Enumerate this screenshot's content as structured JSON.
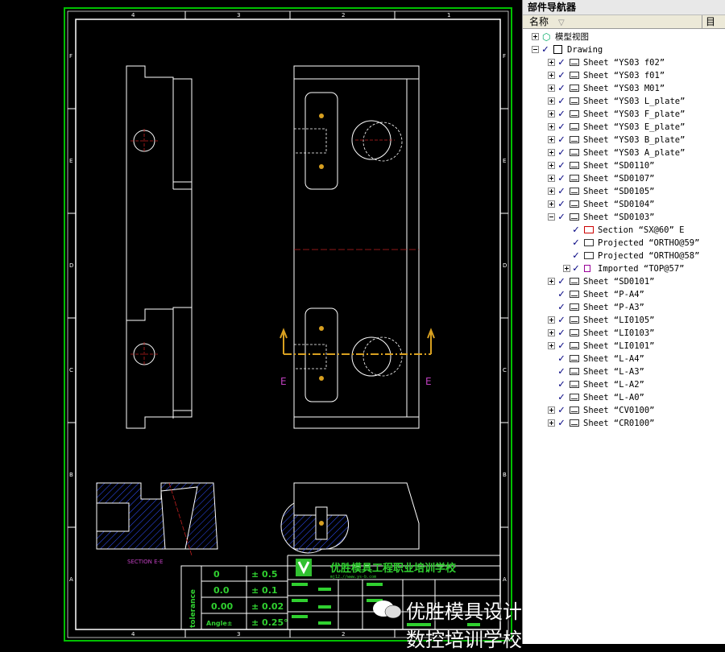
{
  "drawing": {
    "zone_numbers": [
      "4",
      "3",
      "2",
      "1"
    ],
    "zone_letters": [
      "F",
      "E",
      "D",
      "C",
      "B",
      "A"
    ],
    "section_label": "SECTION E-E",
    "cut_marks": [
      "E",
      "E"
    ],
    "colors": {
      "border": "#00c000",
      "frame": "#ffffff",
      "hatch": "#3050ff",
      "center": "#c02020",
      "section": "#d8a020",
      "label": "#c040c0",
      "title": "#30d030"
    },
    "title_block": {
      "school": "优胜模具工程职业培训学校",
      "website": "mj12.//www.ys-b.com",
      "tolerance_label": "tolerance",
      "tol_rows": [
        {
          "left": "0",
          "right": "± 0.5"
        },
        {
          "left": "0.0",
          "right": "± 0.1"
        },
        {
          "left": "0.00",
          "right": "± 0.02"
        },
        {
          "left": "Angle±",
          "right": "± 0.25°"
        }
      ]
    }
  },
  "panel": {
    "title": "部件导航器",
    "col_name": "名称",
    "col_arrow": "▽",
    "col_extra": "目",
    "tree": [
      {
        "level": 0,
        "exp": "plus",
        "check": false,
        "icon": "mv",
        "label": "模型视图"
      },
      {
        "level": 0,
        "exp": "minus",
        "check": true,
        "icon": "dr",
        "label": "Drawing"
      },
      {
        "level": 1,
        "exp": "plus",
        "check": true,
        "icon": "sheet",
        "label": "Sheet “YS03 f02”"
      },
      {
        "level": 1,
        "exp": "plus",
        "check": true,
        "icon": "sheet",
        "label": "Sheet “YS03 f01”"
      },
      {
        "level": 1,
        "exp": "plus",
        "check": true,
        "icon": "sheet",
        "label": "Sheet “YS03 M01”"
      },
      {
        "level": 1,
        "exp": "plus",
        "check": true,
        "icon": "sheet",
        "label": "Sheet “YS03 L_plate”"
      },
      {
        "level": 1,
        "exp": "plus",
        "check": true,
        "icon": "sheet",
        "label": "Sheet “YS03 F_plate”"
      },
      {
        "level": 1,
        "exp": "plus",
        "check": true,
        "icon": "sheet",
        "label": "Sheet “YS03 E_plate”"
      },
      {
        "level": 1,
        "exp": "plus",
        "check": true,
        "icon": "sheet",
        "label": "Sheet “YS03 B_plate”"
      },
      {
        "level": 1,
        "exp": "plus",
        "check": true,
        "icon": "sheet",
        "label": "Sheet “YS03 A_plate”"
      },
      {
        "level": 1,
        "exp": "plus",
        "check": true,
        "icon": "sheet",
        "label": "Sheet “SD0110”"
      },
      {
        "level": 1,
        "exp": "plus",
        "check": true,
        "icon": "sheet",
        "label": "Sheet “SD0107”"
      },
      {
        "level": 1,
        "exp": "plus",
        "check": true,
        "icon": "sheet",
        "label": "Sheet “SD0105”"
      },
      {
        "level": 1,
        "exp": "plus",
        "check": true,
        "icon": "sheet",
        "label": "Sheet “SD0104”"
      },
      {
        "level": 1,
        "exp": "minus",
        "check": true,
        "icon": "sheet",
        "label": "Sheet “SD0103”"
      },
      {
        "level": 2,
        "exp": "",
        "check": true,
        "icon": "sec",
        "label": "Section “SX@60” E"
      },
      {
        "level": 2,
        "exp": "",
        "check": true,
        "icon": "proj",
        "label": "Projected “ORTHO@59”"
      },
      {
        "level": 2,
        "exp": "",
        "check": true,
        "icon": "proj",
        "label": "Projected “ORTHO@58”"
      },
      {
        "level": 2,
        "exp": "plus",
        "check": true,
        "icon": "imp",
        "label": "Imported “TOP@57”"
      },
      {
        "level": 1,
        "exp": "plus",
        "check": true,
        "icon": "sheet",
        "label": "Sheet “SD0101”"
      },
      {
        "level": 1,
        "exp": "",
        "check": true,
        "icon": "sheet",
        "label": "Sheet “P-A4”"
      },
      {
        "level": 1,
        "exp": "",
        "check": true,
        "icon": "sheet",
        "label": "Sheet “P-A3”"
      },
      {
        "level": 1,
        "exp": "plus",
        "check": true,
        "icon": "sheet",
        "label": "Sheet “LI0105”"
      },
      {
        "level": 1,
        "exp": "plus",
        "check": true,
        "icon": "sheet",
        "label": "Sheet “LI0103”"
      },
      {
        "level": 1,
        "exp": "plus",
        "check": true,
        "icon": "sheet",
        "label": "Sheet “LI0101”"
      },
      {
        "level": 1,
        "exp": "",
        "check": true,
        "icon": "sheet",
        "label": "Sheet “L-A4”"
      },
      {
        "level": 1,
        "exp": "",
        "check": true,
        "icon": "sheet",
        "label": "Sheet “L-A3”"
      },
      {
        "level": 1,
        "exp": "",
        "check": true,
        "icon": "sheet",
        "label": "Sheet “L-A2”"
      },
      {
        "level": 1,
        "exp": "",
        "check": true,
        "icon": "sheet",
        "label": "Sheet “L-A0”"
      },
      {
        "level": 1,
        "exp": "plus",
        "check": true,
        "icon": "sheet",
        "label": "Sheet “CV0100”"
      },
      {
        "level": 1,
        "exp": "plus",
        "check": true,
        "icon": "sheet",
        "label": "Sheet “CR0100”"
      }
    ]
  },
  "watermark": "优胜模具设计数控培训学校"
}
